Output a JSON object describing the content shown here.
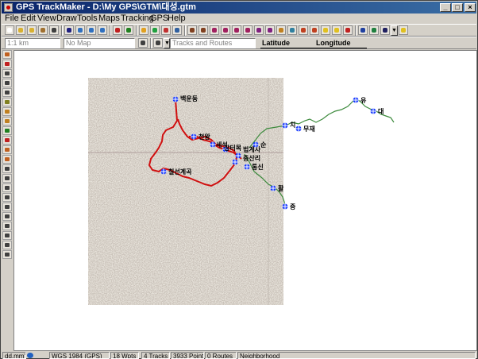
{
  "window": {
    "title": "GPS TrackMaker - D:\\My GPS\\GTM\\대성.gtm",
    "minimize": "_",
    "maximize": "□",
    "close": "×"
  },
  "menu": [
    "File",
    "Edit",
    "View",
    "Draw",
    "Tools",
    "Maps",
    "Tracking",
    "GPS",
    "Help"
  ],
  "toolbar2": {
    "scale_value": "1:1 km",
    "map_value": "No Map",
    "tracks_value": "Tracks and Routes",
    "latitude_label": "Latitude",
    "longitude_label": "Longitude"
  },
  "waypoints": [
    {
      "name": "백운동"
    },
    {
      "name": "칠선계곡"
    },
    {
      "name": "천왕"
    },
    {
      "name": "세석"
    },
    {
      "name": "장터목"
    },
    {
      "name": "법계사"
    },
    {
      "name": "중산리"
    },
    {
      "name": "통신"
    },
    {
      "name": "순"
    },
    {
      "name": "치"
    },
    {
      "name": "무재"
    },
    {
      "name": "유"
    },
    {
      "name": "대"
    },
    {
      "name": "활"
    },
    {
      "name": "중"
    }
  ],
  "statusbar": {
    "units": "dd.mm'ss\"",
    "datum": "WGS 1984 (GPS)",
    "waypoints": "18 Wpts",
    "tracks": "4 Tracks",
    "points": "3933 Points",
    "routes": "0 Routes",
    "mode": "Neighborhood"
  },
  "colors": {
    "title_start": "#0a246a",
    "title_end": "#3a6ea5",
    "track_red": "#d01010",
    "track_green": "#3c8a3c",
    "waypoint_blue": "#1a3cff"
  }
}
